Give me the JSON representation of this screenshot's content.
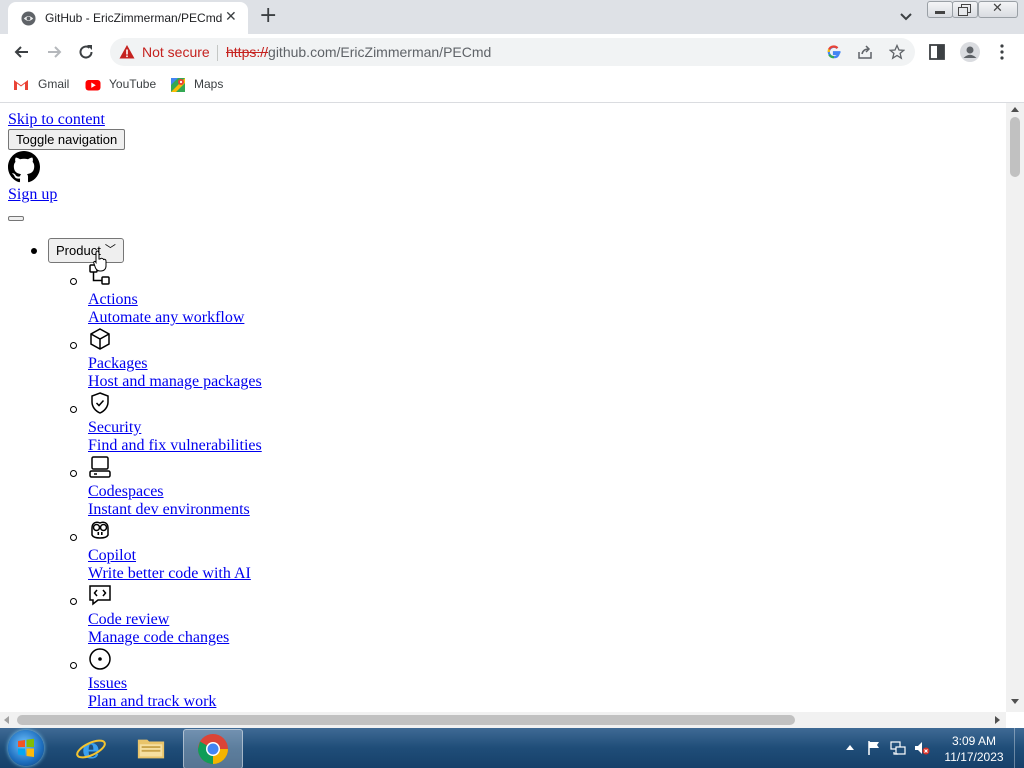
{
  "browser": {
    "tab_title": "GitHub - EricZimmerman/PECmd",
    "security_label": "Not secure",
    "url_scheme": "https://",
    "url_rest": "github.com/EricZimmerman/PECmd",
    "bookmarks": [
      "Gmail",
      "YouTube",
      "Maps"
    ]
  },
  "page": {
    "skip_link": "Skip to content",
    "toggle_nav": "Toggle navigation",
    "sign_up": "Sign up",
    "product_button": "Product",
    "product_items": [
      {
        "name": "Actions",
        "desc": "Automate any workflow",
        "icon": "actions-icon"
      },
      {
        "name": "Packages",
        "desc": "Host and manage packages",
        "icon": "package-icon"
      },
      {
        "name": "Security",
        "desc": "Find and fix vulnerabilities",
        "icon": "shield-check-icon"
      },
      {
        "name": "Codespaces",
        "desc": "Instant dev environments",
        "icon": "codespaces-icon"
      },
      {
        "name": "Copilot",
        "desc": "Write better code with AI",
        "icon": "copilot-icon"
      },
      {
        "name": "Code review",
        "desc": "Manage code changes",
        "icon": "code-review-icon"
      },
      {
        "name": "Issues",
        "desc": "Plan and track work",
        "icon": "issue-opened-icon"
      }
    ]
  },
  "taskbar": {
    "time": "3:09 AM",
    "date": "11/17/2023"
  }
}
